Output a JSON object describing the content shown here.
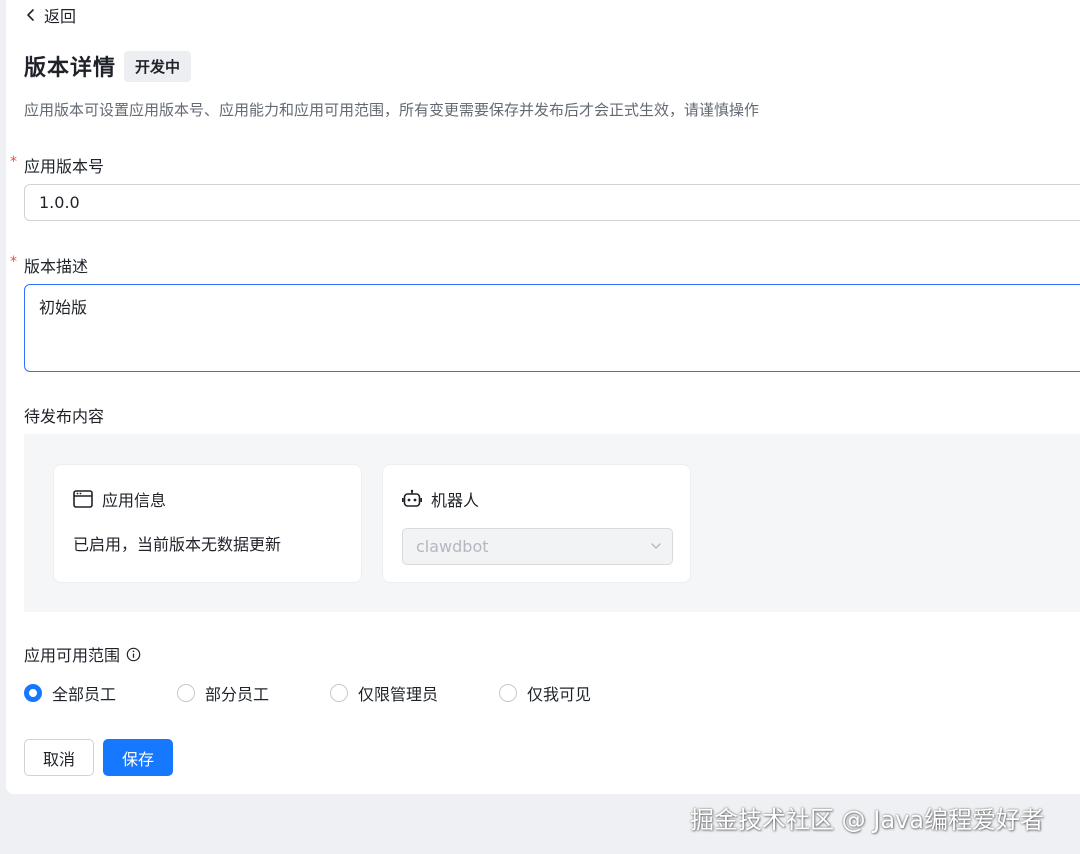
{
  "nav": {
    "back_label": "返回"
  },
  "header": {
    "title": "版本详情",
    "status_badge": "开发中"
  },
  "description": "应用版本可设置应用版本号、应用能力和应用可用范围，所有变更需要保存并发布后才会正式生效，请谨慎操作",
  "form": {
    "version_number": {
      "label": "应用版本号",
      "required_mark": "*",
      "value": "1.0.0"
    },
    "version_desc": {
      "label": "版本描述",
      "required_mark": "*",
      "value": "初始版"
    }
  },
  "pending": {
    "label": "待发布内容",
    "cards": [
      {
        "title": "应用信息",
        "icon": "window-icon",
        "text": "已启用，当前版本无数据更新"
      },
      {
        "title": "机器人",
        "icon": "robot-icon",
        "select_value": "clawdbot"
      }
    ]
  },
  "scope": {
    "label": "应用可用范围",
    "info_icon": "info-icon",
    "options": [
      {
        "label": "全部员工",
        "selected": true
      },
      {
        "label": "部分员工",
        "selected": false
      },
      {
        "label": "仅限管理员",
        "selected": false
      },
      {
        "label": "仅我可见",
        "selected": false
      }
    ]
  },
  "actions": {
    "cancel_label": "取消",
    "save_label": "保存"
  },
  "watermark": "掘金技术社区 @ Java编程爱好者",
  "colors": {
    "primary": "#1677ff",
    "required": "#f54a45",
    "muted": "#646a73"
  }
}
